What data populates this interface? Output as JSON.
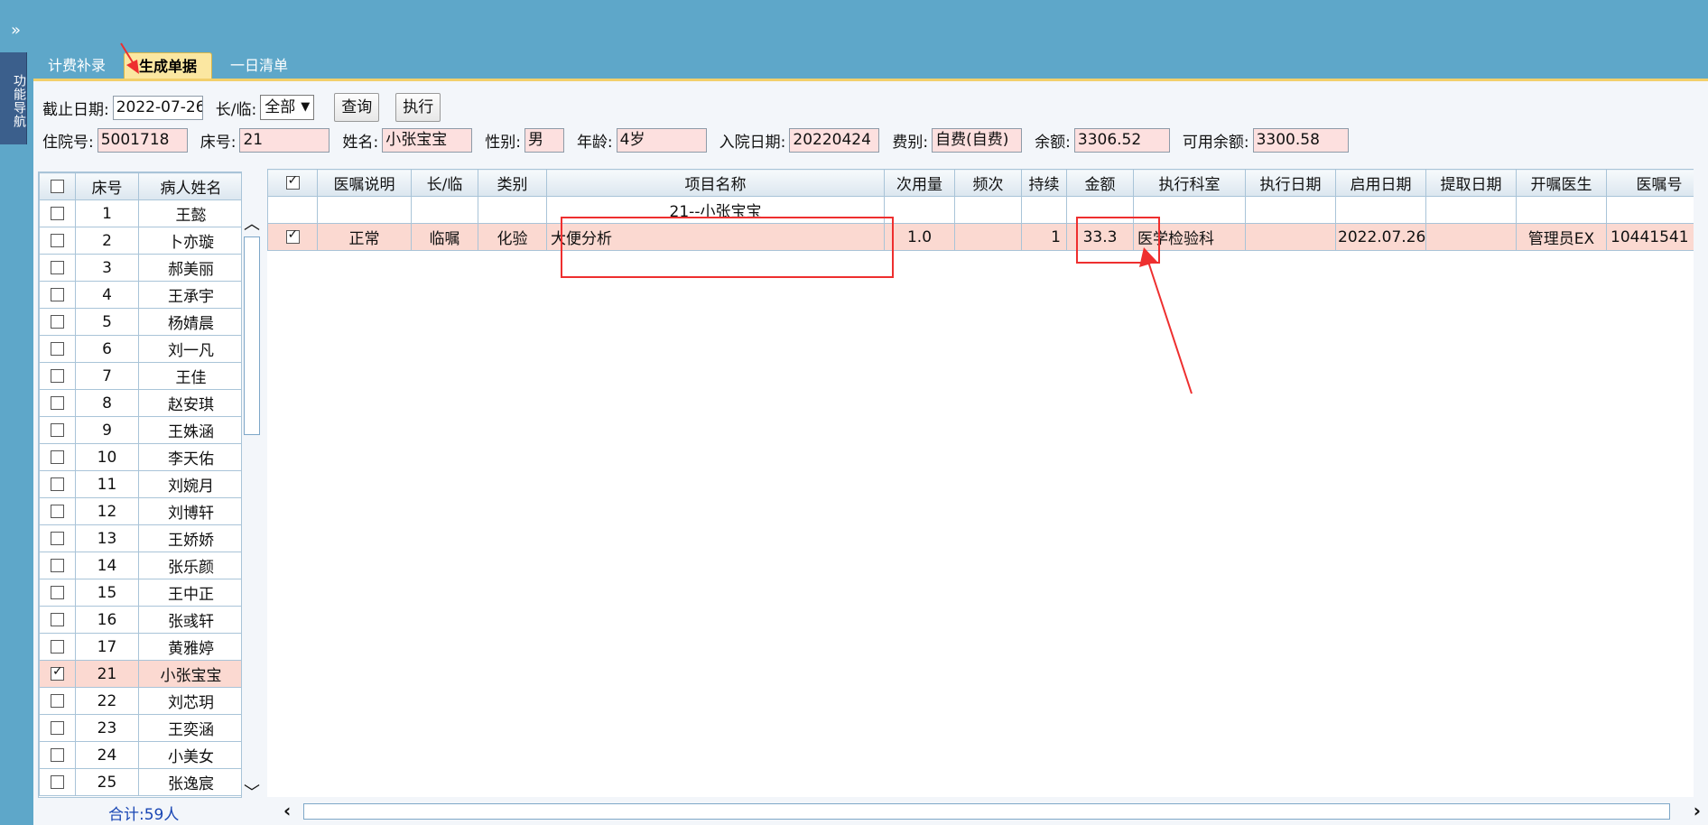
{
  "nav": {
    "toggle": "»",
    "tab_label": "功能导航"
  },
  "tabs": [
    {
      "label": "计费补录"
    },
    {
      "label": "生成单据"
    },
    {
      "label": "一日清单"
    }
  ],
  "filters": {
    "cutoff_label": "截止日期:",
    "cutoff_value": "2022-07-26",
    "type_label": "长/临:",
    "type_value": "全部",
    "query_button": "查询",
    "execute_button": "执行"
  },
  "patient": {
    "admission_no_label": "住院号:",
    "admission_no": "5001718",
    "bed_label": "床号:",
    "bed": "21",
    "name_label": "姓名:",
    "name": "小张宝宝",
    "gender_label": "性别:",
    "gender": "男",
    "age_label": "年龄:",
    "age": "4岁",
    "admit_date_label": "入院日期:",
    "admit_date": "20220424",
    "fee_type_label": "费别:",
    "fee_type": "自费(自费)",
    "balance_label": "余额:",
    "balance": "3306.52",
    "available_label": "可用余额:",
    "available": "3300.58"
  },
  "patient_list": {
    "headers": {
      "bed": "床号",
      "name": "病人姓名"
    },
    "rows": [
      {
        "bed": "1",
        "name": "王懿",
        "checked": false
      },
      {
        "bed": "2",
        "name": "卜亦璇",
        "checked": false
      },
      {
        "bed": "3",
        "name": "郝美丽",
        "checked": false
      },
      {
        "bed": "4",
        "name": "王承宇",
        "checked": false
      },
      {
        "bed": "5",
        "name": "杨婧晨",
        "checked": false
      },
      {
        "bed": "6",
        "name": "刘一凡",
        "checked": false
      },
      {
        "bed": "7",
        "name": "王佳",
        "checked": false
      },
      {
        "bed": "8",
        "name": "赵安琪",
        "checked": false
      },
      {
        "bed": "9",
        "name": "王姝涵",
        "checked": false
      },
      {
        "bed": "10",
        "name": "李天佑",
        "checked": false
      },
      {
        "bed": "11",
        "name": "刘婉月",
        "checked": false
      },
      {
        "bed": "12",
        "name": "刘博轩",
        "checked": false
      },
      {
        "bed": "13",
        "name": "王娇娇",
        "checked": false
      },
      {
        "bed": "14",
        "name": "张乐颜",
        "checked": false
      },
      {
        "bed": "15",
        "name": "王中正",
        "checked": false
      },
      {
        "bed": "16",
        "name": "张彧轩",
        "checked": false
      },
      {
        "bed": "17",
        "name": "黄雅婷",
        "checked": false
      },
      {
        "bed": "21",
        "name": "小张宝宝",
        "checked": true
      },
      {
        "bed": "22",
        "name": "刘芯玥",
        "checked": false
      },
      {
        "bed": "23",
        "name": "王奕涵",
        "checked": false
      },
      {
        "bed": "24",
        "name": "小美女",
        "checked": false
      },
      {
        "bed": "25",
        "name": "张逸宸",
        "checked": false
      }
    ],
    "total": "合计:59人"
  },
  "orders": {
    "headers": {
      "note": "医嘱说明",
      "type": "长/临",
      "category": "类别",
      "item": "项目名称",
      "dose": "次用量",
      "freq": "频次",
      "duration": "持续",
      "amount": "金额",
      "dept": "执行科室",
      "exec_date": "执行日期",
      "start_date": "启用日期",
      "extract_date": "提取日期",
      "doctor": "开嘱医生",
      "order_no": "医嘱号"
    },
    "group_label": "21--小张宝宝",
    "row": {
      "checked": true,
      "note": "正常",
      "type": "临嘱",
      "category": "化验",
      "item": "大便分析",
      "dose": "1.0",
      "freq": "",
      "duration": "1",
      "amount": "33.3",
      "dept": "医学检验科",
      "exec_date": "",
      "start_date": "2022.07.26",
      "extract_date": "",
      "doctor": "管理员EX",
      "order_no": "10441541"
    }
  },
  "colors": {
    "background": "#5ea7c9",
    "selected_row": "#fbd9d1",
    "annotation": "#ee2f2f",
    "active_tab": "#fbe7a1"
  }
}
